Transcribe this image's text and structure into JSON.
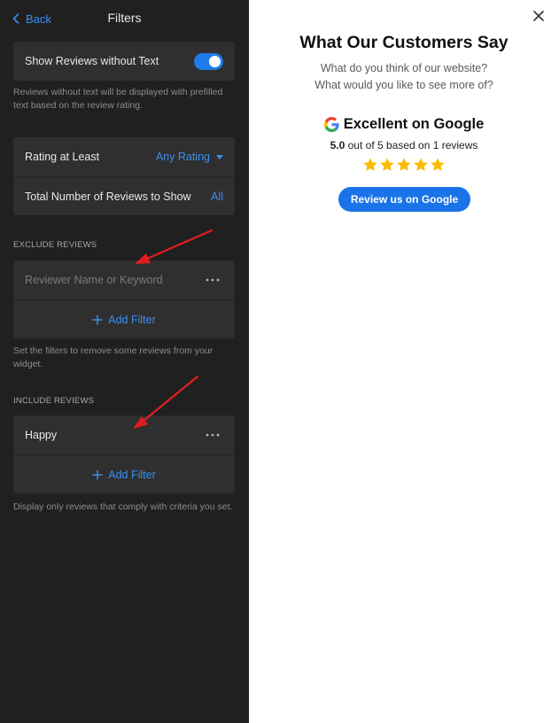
{
  "header": {
    "back_label": "Back",
    "title": "Filters"
  },
  "show_without_text": {
    "label": "Show Reviews without Text",
    "enabled": true,
    "help": "Reviews without text will be displayed with prefilled text based on the review rating."
  },
  "rating_settings": {
    "rating_label": "Rating at Least",
    "rating_value": "Any Rating",
    "count_label": "Total Number of Reviews to Show",
    "count_value": "All"
  },
  "exclude": {
    "section_title": "EXCLUDE REVIEWS",
    "input_value": "",
    "input_placeholder": "Reviewer Name or Keyword",
    "add_filter_label": "Add Filter",
    "help": "Set the filters to remove some reviews from your widget."
  },
  "include": {
    "section_title": "INCLUDE REVIEWS",
    "keyword": "Happy",
    "add_filter_label": "Add Filter",
    "help": "Display only reviews that comply with criteria you set."
  },
  "preview": {
    "title": "What Our Customers Say",
    "subtitle_line1": "What do you think of our website?",
    "subtitle_line2": "What would you like to see more of?",
    "rating_text": "Excellent on Google",
    "score": "5.0",
    "based_text": " out of 5 based on 1 reviews",
    "stars": 5,
    "button_label": "Review us on Google"
  },
  "icons": {
    "back": "chevron-left-icon",
    "menu": "more-horizontal-icon",
    "add": "plus-icon",
    "close": "close-icon",
    "brand": "google-g-icon",
    "star": "star-icon",
    "annotation": "red-arrow"
  },
  "colors": {
    "panel_bg": "#202020",
    "card_bg": "#2f2f2f",
    "accent": "#3b8ff2",
    "toggle_on": "#1f7be8",
    "button": "#1a73e8",
    "star": "#fbbc04",
    "arrow": "#e01e1e"
  }
}
